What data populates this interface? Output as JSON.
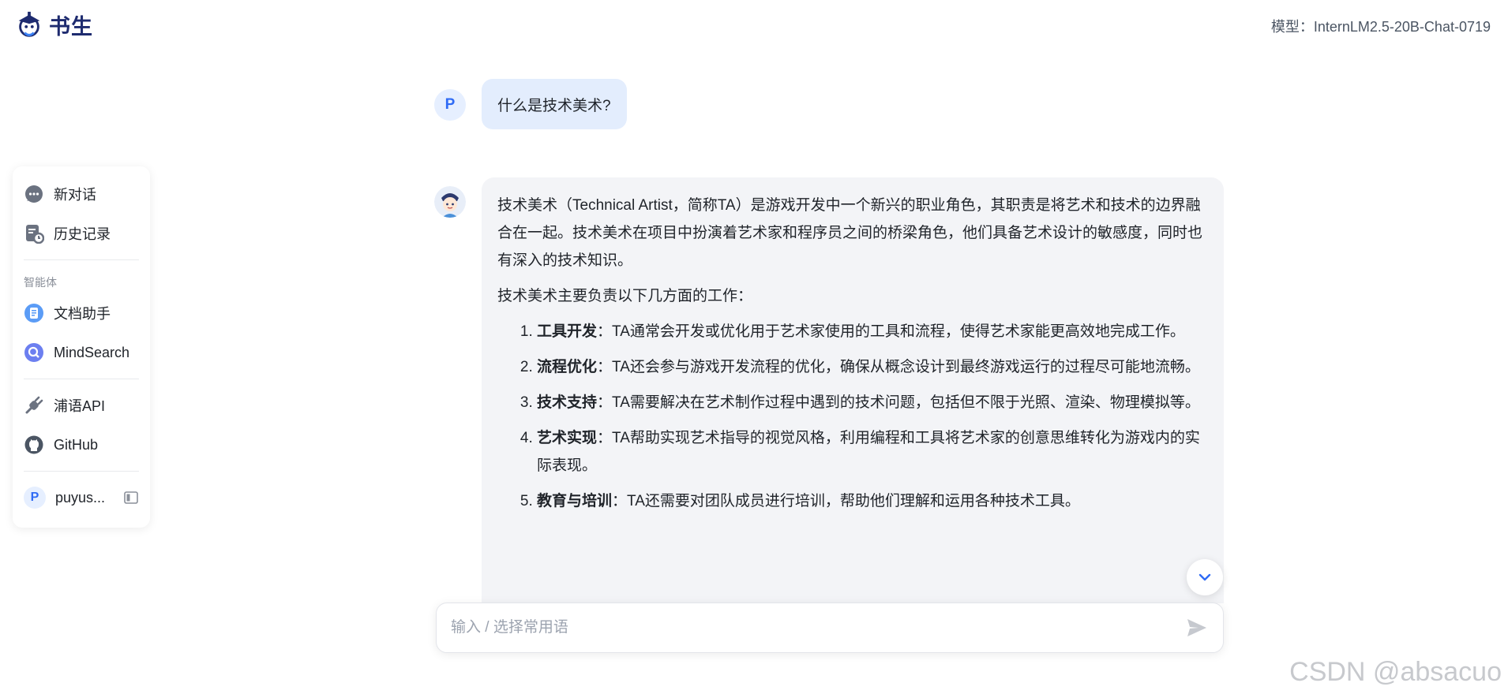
{
  "header": {
    "logo_text": "书生",
    "model_label": "模型：InternLM2.5-20B-Chat-0719"
  },
  "sidebar": {
    "top_items": [
      {
        "label": "新对话",
        "icon": "chat-bubble-icon"
      },
      {
        "label": "历史记录",
        "icon": "history-icon"
      }
    ],
    "agents_section_label": "智能体",
    "agent_items": [
      {
        "label": "文档助手",
        "icon": "document-assistant-icon"
      },
      {
        "label": "MindSearch",
        "icon": "mindsearch-icon"
      }
    ],
    "link_items": [
      {
        "label": "浦语API",
        "icon": "plug-icon"
      },
      {
        "label": "GitHub",
        "icon": "github-icon"
      }
    ],
    "user": {
      "avatar_letter": "P",
      "name": "puyus..."
    }
  },
  "chat": {
    "user_avatar_letter": "P",
    "user_message": "什么是技术美术?",
    "bot_paragraphs": [
      "技术美术（Technical Artist，简称TA）是游戏开发中一个新兴的职业角色，其职责是将艺术和技术的边界融合在一起。技术美术在项目中扮演着艺术家和程序员之间的桥梁角色，他们具备艺术设计的敏感度，同时也有深入的技术知识。",
      "技术美术主要负责以下几方面的工作："
    ],
    "bot_list": [
      {
        "title": "工具开发",
        "text": "：TA通常会开发或优化用于艺术家使用的工具和流程，使得艺术家能更高效地完成工作。"
      },
      {
        "title": "流程优化",
        "text": "：TA还会参与游戏开发流程的优化，确保从概念设计到最终游戏运行的过程尽可能地流畅。"
      },
      {
        "title": "技术支持",
        "text": "：TA需要解决在艺术制作过程中遇到的技术问题，包括但不限于光照、渲染、物理模拟等。"
      },
      {
        "title": "艺术实现",
        "text": "：TA帮助实现艺术指导的视觉风格，利用编程和工具将艺术家的创意思维转化为游戏内的实际表现。"
      },
      {
        "title": "教育与培训",
        "text": "：TA还需要对团队成员进行培训，帮助他们理解和运用各种技术工具。"
      }
    ]
  },
  "input": {
    "placeholder": "输入 / 选择常用语",
    "value": ""
  },
  "watermark": "CSDN @absacuo",
  "colors": {
    "accent": "#2f6bf5",
    "user_bubble": "#e3edfd",
    "bot_bubble": "#f3f4f7",
    "logo": "#1e2b6f"
  }
}
